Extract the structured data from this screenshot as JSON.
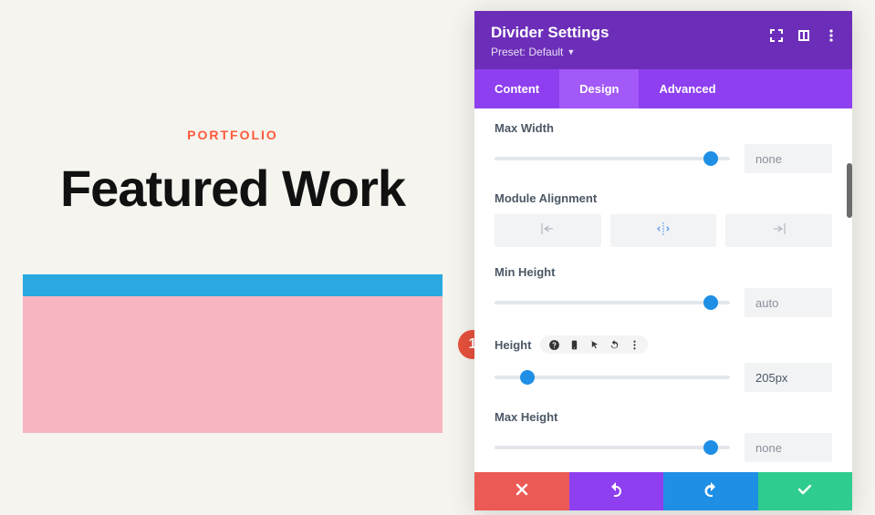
{
  "preview": {
    "eyebrow": "PORTFOLIO",
    "headline": "Featured Work"
  },
  "annotation": {
    "one": "1"
  },
  "panel": {
    "title": "Divider Settings",
    "preset": "Preset: Default"
  },
  "tabs": {
    "content": "Content",
    "design": "Design",
    "advanced": "Advanced"
  },
  "fields": {
    "maxWidth": {
      "label": "Max Width",
      "value": "none",
      "thumb": 92
    },
    "alignment": {
      "label": "Module Alignment"
    },
    "minHeight": {
      "label": "Min Height",
      "value": "auto",
      "thumb": 92
    },
    "height": {
      "label": "Height",
      "value": "205px",
      "thumb": 14
    },
    "maxHeight": {
      "label": "Max Height",
      "value": "none",
      "thumb": 92
    }
  }
}
